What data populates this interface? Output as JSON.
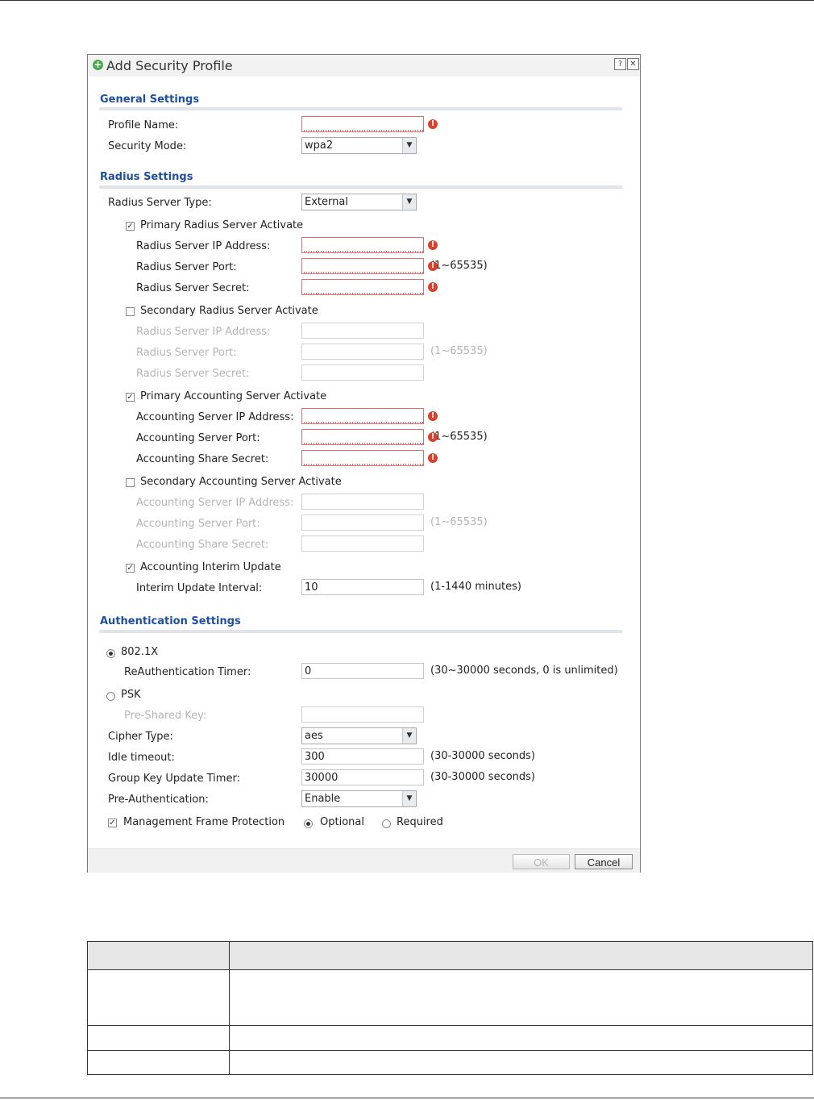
{
  "dialog": {
    "title": "Add Security Profile",
    "help_glyph": "?",
    "close_glyph": "✕"
  },
  "general": {
    "heading": "General Settings",
    "profile_name_label": "Profile Name:",
    "profile_name_value": "",
    "security_mode_label": "Security Mode:",
    "security_mode_value": "wpa2"
  },
  "radius": {
    "heading": "Radius Settings",
    "server_type_label": "Radius Server Type:",
    "server_type_value": "External",
    "primary_activate_label": "Primary Radius Server Activate",
    "primary_activate_checked": true,
    "primary_ip_label": "Radius Server IP Address:",
    "primary_port_label": "Radius Server Port:",
    "primary_port_hint": "(1~65535)",
    "primary_secret_label": "Radius Server Secret:",
    "secondary_activate_label": "Secondary Radius Server Activate",
    "secondary_activate_checked": false,
    "secondary_ip_label": "Radius Server IP Address:",
    "secondary_port_label": "Radius Server Port:",
    "secondary_port_hint": "(1~65535)",
    "secondary_secret_label": "Radius Server Secret:",
    "acct_primary_activate_label": "Primary Accounting Server Activate",
    "acct_primary_activate_checked": true,
    "acct_primary_ip_label": "Accounting Server IP Address:",
    "acct_primary_port_label": "Accounting Server Port:",
    "acct_primary_port_hint": "(1~65535)",
    "acct_primary_secret_label": "Accounting Share Secret:",
    "acct_secondary_activate_label": "Secondary Accounting Server Activate",
    "acct_secondary_activate_checked": false,
    "acct_secondary_ip_label": "Accounting Server IP Address:",
    "acct_secondary_port_label": "Accounting Server Port:",
    "acct_secondary_port_hint": "(1~65535)",
    "acct_secondary_secret_label": "Accounting Share Secret:",
    "interim_update_label": "Accounting Interim Update",
    "interim_update_checked": true,
    "interim_interval_label": "Interim Update Interval:",
    "interim_interval_value": "10",
    "interim_interval_hint": "(1-1440 minutes)"
  },
  "auth": {
    "heading": "Authentication Settings",
    "dot1x_label": "802.1X",
    "dot1x_selected": true,
    "reauth_label": "ReAuthentication Timer:",
    "reauth_value": "0",
    "reauth_hint": "(30~30000 seconds, 0 is unlimited)",
    "psk_label": "PSK",
    "psk_selected": false,
    "psk_key_label": "Pre-Shared Key:",
    "cipher_label": "Cipher Type:",
    "cipher_value": "aes",
    "idle_label": "Idle timeout:",
    "idle_value": "300",
    "idle_hint": "(30-30000 seconds)",
    "group_key_label": "Group Key Update Timer:",
    "group_key_value": "30000",
    "group_key_hint": "(30-30000 seconds)",
    "preauth_label": "Pre-Authentication:",
    "preauth_value": "Enable",
    "mfp_label": "Management Frame Protection",
    "mfp_checked": true,
    "mfp_optional_label": "Optional",
    "mfp_required_label": "Required"
  },
  "buttons": {
    "ok_label": "OK",
    "cancel_label": "Cancel"
  },
  "icons": {
    "error": "!",
    "check": "✓",
    "arrow": "▼",
    "add": "+"
  },
  "colors": {
    "section_heading": "#1e4fa0",
    "error": "#d9412f",
    "add_icon": "#4da64d"
  }
}
